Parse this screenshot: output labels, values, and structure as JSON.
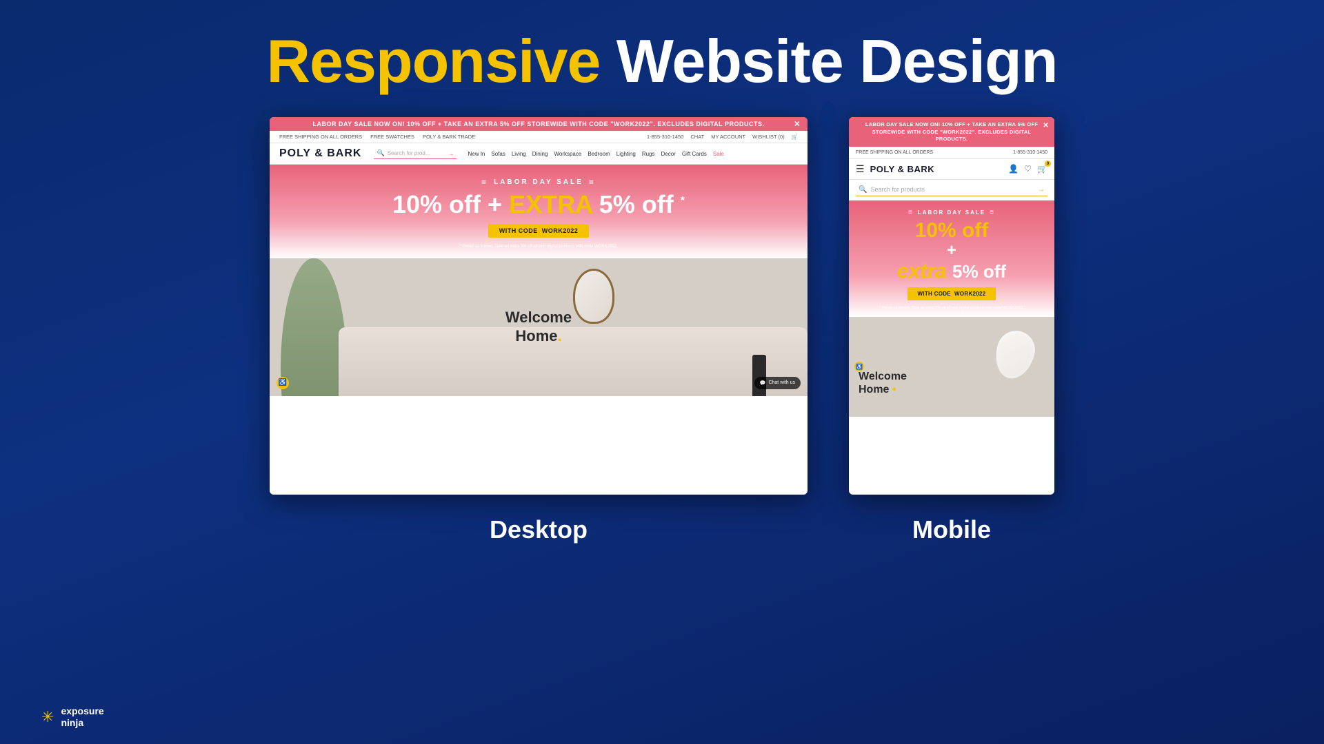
{
  "page": {
    "title_responsive": "Responsive",
    "title_website_design": "Website Design"
  },
  "desktop": {
    "label": "Desktop",
    "announcement": "LABOR DAY SALE NOW ON! 10% OFF + TAKE AN EXTRA 5% OFF STOREWIDE WITH CODE \"WORK2022\". EXCLUDES DIGITAL PRODUCTS.",
    "utility_left": [
      "FREE SHIPPING ON ALL ORDERS",
      "FREE SWATCHES",
      "POLY & BARK TRADE"
    ],
    "utility_right": [
      "1-855-310-1450",
      "CHAT",
      "MY ACCOUNT",
      "WISHLIST (0)"
    ],
    "brand": "POLY & BARK",
    "search_placeholder": "Search for prod...",
    "nav_links": [
      "New In",
      "Sofas",
      "Living",
      "Dining",
      "Workspace",
      "Bedroom",
      "Lighting",
      "Rugs",
      "Decor",
      "Gift Cards",
      "Sale"
    ],
    "labor_day_title": "LABOR DAY SALE",
    "sale_line1": "10% off",
    "sale_plus": "+",
    "sale_extra": "EXTRA",
    "sale_line2": "5% off",
    "sale_asterisk": "*",
    "code_label": "WITH CODE",
    "code_value": "WORK2022",
    "fine_print": "* Prices as shown. Take an extra 5% off all non digital products with code WORK2022.",
    "welcome_text": "Welcome\nHome.",
    "chat_text": "Chat with us"
  },
  "mobile": {
    "label": "Mobile",
    "announcement": "LABOR DAY SALE NOW ON! 10% OFF + TAKE AN EXTRA 5% OFF STOREWIDE WITH CODE \"WORK2022\". EXCLUDES DIGITAL PRODUCTS.",
    "top_left": "FREE SHIPPING ON ALL ORDERS",
    "top_right": "1-855-310-1450",
    "brand": "POLY & BARK",
    "search_placeholder": "Search for products",
    "labor_day_title": "LABOR DAY SALE",
    "sale_line1": "10% off",
    "sale_plus": "+",
    "sale_extra": "extra",
    "sale_line2": "5% off",
    "sale_asterisk": "*",
    "code_label": "WITH CODE",
    "code_value": "WORK2022",
    "fine_print": "* Prices as shown. Take an extra 5% off all non digital products with code WORK2022.",
    "welcome_text": "Welcome\nHome.",
    "welcome_dot": "•"
  },
  "branding": {
    "logo_name": "exposure ninja",
    "logo_sub": "ninja"
  }
}
